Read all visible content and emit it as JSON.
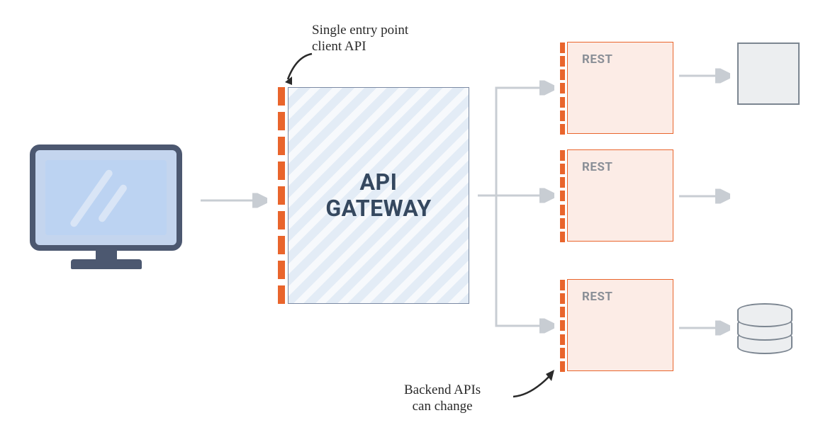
{
  "client": {
    "name": "client-monitor"
  },
  "gateway": {
    "label_line1": "API",
    "label_line2": "GATEWAY"
  },
  "services": [
    {
      "label": "REST"
    },
    {
      "label": "REST"
    },
    {
      "label": "REST"
    }
  ],
  "annotations": {
    "entry_point": "Single entry point\nclient API",
    "backend_change": "Backend APIs\ncan change"
  }
}
